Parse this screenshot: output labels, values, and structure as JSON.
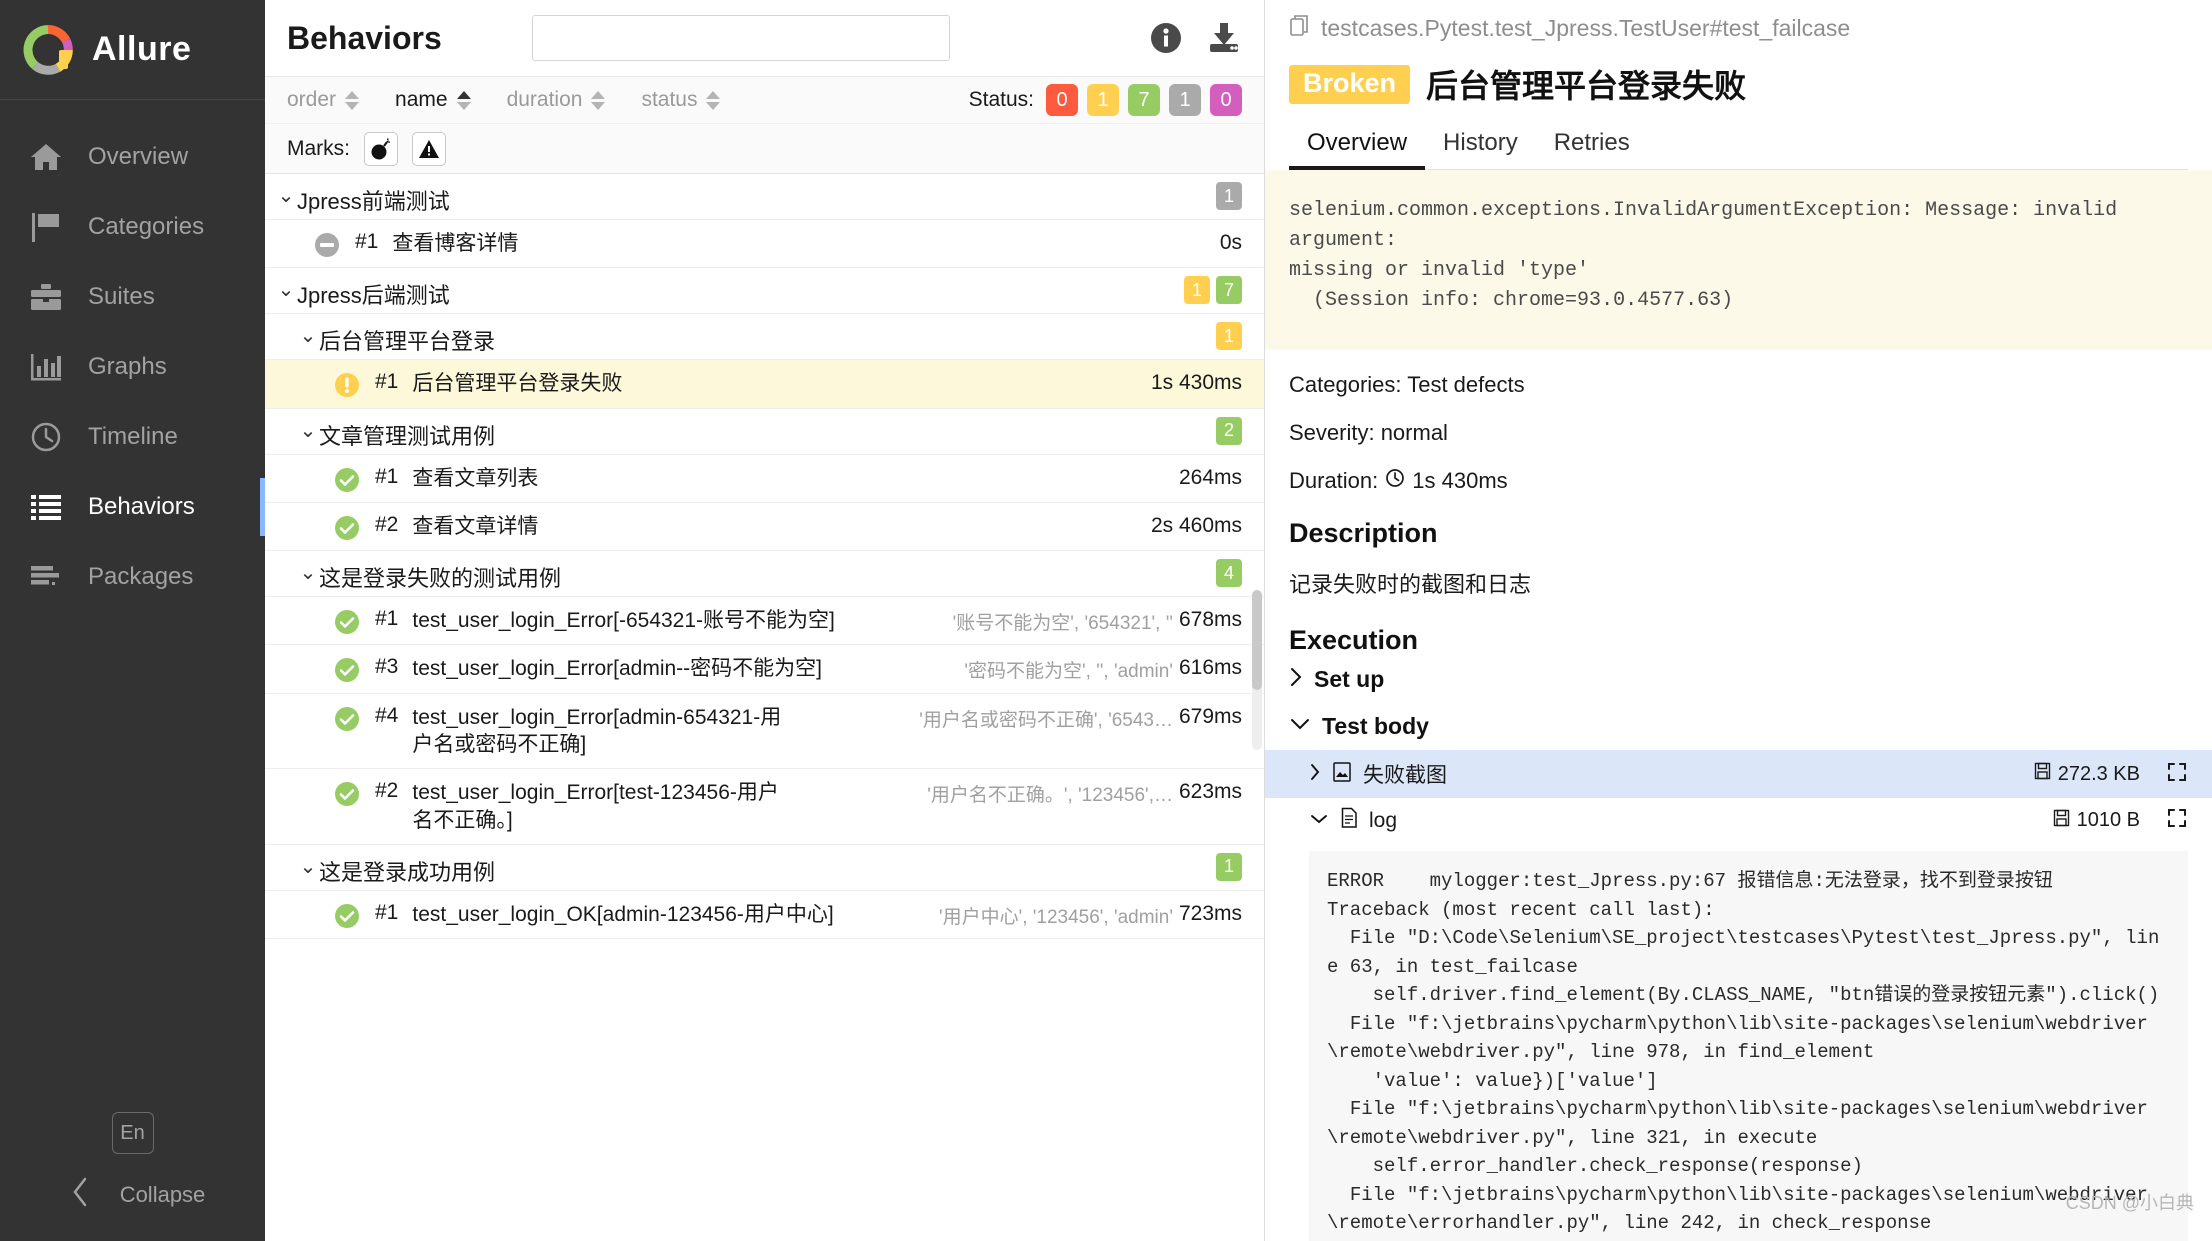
{
  "sidebar": {
    "brand": "Allure",
    "items": [
      {
        "label": "Overview",
        "icon": "home-icon",
        "active": false
      },
      {
        "label": "Categories",
        "icon": "flag-icon",
        "active": false
      },
      {
        "label": "Suites",
        "icon": "briefcase-icon",
        "active": false
      },
      {
        "label": "Graphs",
        "icon": "bar-chart-icon",
        "active": false
      },
      {
        "label": "Timeline",
        "icon": "clock-icon",
        "active": false
      },
      {
        "label": "Behaviors",
        "icon": "list-icon",
        "active": true
      },
      {
        "label": "Packages",
        "icon": "stack-icon",
        "active": false
      }
    ],
    "language_label": "En",
    "collapse_label": "Collapse"
  },
  "middle": {
    "title": "Behaviors",
    "search_value": "",
    "search_placeholder": "",
    "info_icon": "info-icon",
    "download_icon": "download-icon",
    "sort": [
      {
        "label": "order",
        "active": false
      },
      {
        "label": "name",
        "active": true
      },
      {
        "label": "duration",
        "active": false
      },
      {
        "label": "status",
        "active": false
      }
    ],
    "status_label": "Status:",
    "status_chips": [
      {
        "value": "0",
        "kind": "failed"
      },
      {
        "value": "1",
        "kind": "broken"
      },
      {
        "value": "7",
        "kind": "passed"
      },
      {
        "value": "1",
        "kind": "skipped"
      },
      {
        "value": "0",
        "kind": "unknown"
      }
    ],
    "marks_label": "Marks:",
    "marks": [
      {
        "icon": "bomb-icon"
      },
      {
        "icon": "warning-triangle-icon"
      }
    ],
    "rows": [
      {
        "type": "group",
        "level": 0,
        "label": "Jpress前端测试",
        "expanded": true,
        "badges": [
          {
            "value": "1",
            "kind": "skipped"
          }
        ]
      },
      {
        "type": "test",
        "level": 1,
        "status": "skipped",
        "num": "#1",
        "name": "查看博客详情",
        "params": "",
        "duration": "0s",
        "highlight": false
      },
      {
        "type": "group",
        "level": 0,
        "label": "Jpress后端测试",
        "expanded": true,
        "badges": [
          {
            "value": "1",
            "kind": "broken"
          },
          {
            "value": "7",
            "kind": "passed"
          }
        ]
      },
      {
        "type": "group",
        "level": 1,
        "label": "后台管理平台登录",
        "expanded": true,
        "badges": [
          {
            "value": "1",
            "kind": "broken"
          }
        ]
      },
      {
        "type": "test",
        "level": 2,
        "status": "broken",
        "num": "#1",
        "name": "后台管理平台登录失败",
        "params": "",
        "duration": "1s 430ms",
        "highlight": true
      },
      {
        "type": "group",
        "level": 1,
        "label": "文章管理测试用例",
        "expanded": true,
        "badges": [
          {
            "value": "2",
            "kind": "passed"
          }
        ]
      },
      {
        "type": "test",
        "level": 2,
        "status": "passed",
        "num": "#1",
        "name": "查看文章列表",
        "params": "",
        "duration": "264ms",
        "highlight": false
      },
      {
        "type": "test",
        "level": 2,
        "status": "passed",
        "num": "#2",
        "name": "查看文章详情",
        "params": "",
        "duration": "2s 460ms",
        "highlight": false
      },
      {
        "type": "group",
        "level": 1,
        "label": "这是登录失败的测试用例",
        "expanded": true,
        "badges": [
          {
            "value": "4",
            "kind": "passed"
          }
        ]
      },
      {
        "type": "test",
        "level": 2,
        "status": "passed",
        "num": "#1",
        "name": "test_user_login_Error[-654321-账号不能为空]",
        "params": "'账号不能为空', '654321', ''",
        "duration": "678ms",
        "highlight": false
      },
      {
        "type": "test",
        "level": 2,
        "status": "passed",
        "num": "#3",
        "name": "test_user_login_Error[admin--密码不能为空]",
        "params": "'密码不能为空', '', 'admin'",
        "duration": "616ms",
        "highlight": false
      },
      {
        "type": "test",
        "level": 2,
        "status": "passed",
        "num": "#4",
        "name": "test_user_login_Error[admin-654321-用户名或密码不正确]",
        "params": "'用户名或密码不正确', '6543…",
        "duration": "679ms",
        "highlight": false
      },
      {
        "type": "test",
        "level": 2,
        "status": "passed",
        "num": "#2",
        "name": "test_user_login_Error[test-123456-用户名不正确。]",
        "params": "'用户名不正确。', '123456',…",
        "duration": "623ms",
        "highlight": false
      },
      {
        "type": "group",
        "level": 1,
        "label": "这是登录成功用例",
        "expanded": true,
        "badges": [
          {
            "value": "1",
            "kind": "passed"
          }
        ]
      },
      {
        "type": "test",
        "level": 2,
        "status": "passed",
        "num": "#1",
        "name": "test_user_login_OK[admin-123456-用户中心]",
        "params": "'用户中心', '123456', 'admin'",
        "duration": "723ms",
        "highlight": false
      }
    ]
  },
  "detail": {
    "path_icon": "copy-icon",
    "path": "testcases.Pytest.test_Jpress.TestUser#test_failcase",
    "status_tag": "Broken",
    "title": "后台管理平台登录失败",
    "tabs": [
      {
        "label": "Overview",
        "active": true
      },
      {
        "label": "History",
        "active": false
      },
      {
        "label": "Retries",
        "active": false
      }
    ],
    "error_message": "selenium.common.exceptions.InvalidArgumentException: Message: invalid argument:\nmissing or invalid 'type'\n  (Session info: chrome=93.0.4577.63)",
    "categories": "Categories: Test defects",
    "severity": "Severity: normal",
    "duration_label": "Duration:",
    "duration_value": "1s 430ms",
    "duration_icon": "clock-icon",
    "description_heading": "Description",
    "description_text": "记录失败时的截图和日志",
    "execution_heading": "Execution",
    "setup_label": "Set up",
    "setup_expanded": false,
    "testbody_label": "Test body",
    "testbody_expanded": true,
    "attachments": [
      {
        "name": "失败截图",
        "icon": "image-file-icon",
        "size": "272.3 KB",
        "expanded": false,
        "selected": true,
        "size_icon": "floppy-icon",
        "expand_icon": "fullscreen-icon"
      },
      {
        "name": "log",
        "icon": "text-file-icon",
        "size": "1010 B",
        "expanded": true,
        "selected": false,
        "size_icon": "floppy-icon",
        "expand_icon": "fullscreen-icon"
      }
    ],
    "log_text": "ERROR    mylogger:test_Jpress.py:67 报错信息:无法登录，找不到登录按钮\nTraceback (most recent call last):\n  File \"D:\\Code\\Selenium\\SE_project\\testcases\\Pytest\\test_Jpress.py\", line 63, in test_failcase\n    self.driver.find_element(By.CLASS_NAME, \"btn错误的登录按钮元素\").click()\n  File \"f:\\jetbrains\\pycharm\\python\\lib\\site-packages\\selenium\\webdriver\\remote\\webdriver.py\", line 978, in find_element\n    'value': value})['value']\n  File \"f:\\jetbrains\\pycharm\\python\\lib\\site-packages\\selenium\\webdriver\\remote\\webdriver.py\", line 321, in execute\n    self.error_handler.check_response(response)\n  File \"f:\\jetbrains\\pycharm\\python\\lib\\site-packages\\selenium\\webdriver\\remote\\errorhandler.py\", line 242, in check_response\n    raise exception_class(message, screen, stacktrace)\nselenium.common.exceptions.NoSuchElementException: Message: no such element: Unable to locate element: {\"method\":\"css selector\",\"selector\":\".btn错误的登录按钮元素\"}\n  (Session info: chrome=93.0.4577.63)",
    "watermark": "CSDN @小白典"
  }
}
